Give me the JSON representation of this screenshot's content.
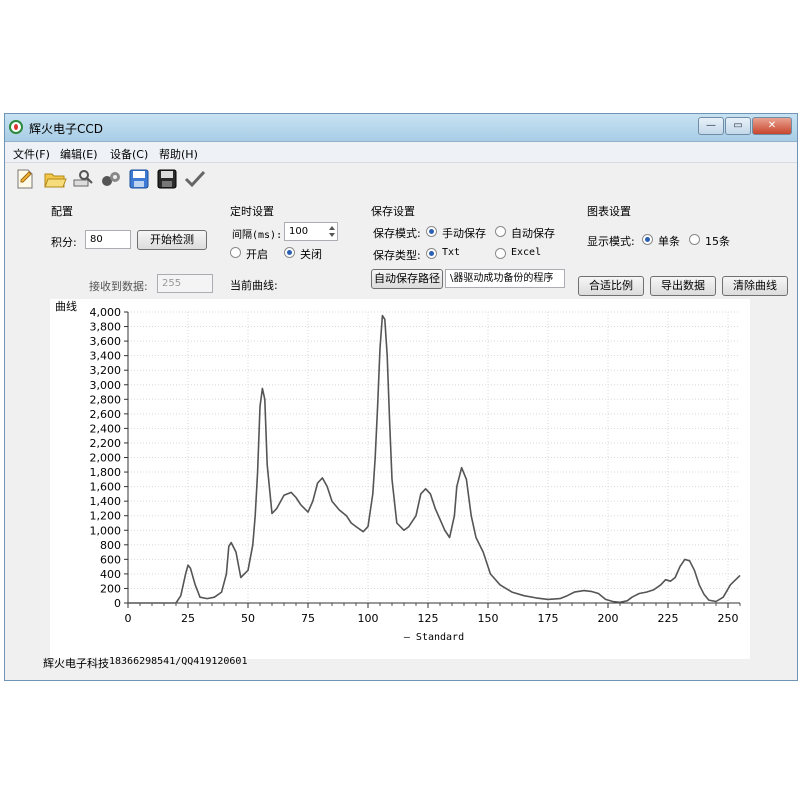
{
  "window": {
    "title": "辉火电子CCD",
    "minimize_label": "—",
    "maximize_label": "▭",
    "close_label": "✕"
  },
  "menu": [
    "文件(F)",
    "编辑(E)",
    "设备(C)",
    "帮助(H)"
  ],
  "toolbar": {
    "icons": [
      "new-file-icon",
      "open-folder-icon",
      "connect-icon",
      "device-icon",
      "save-icon",
      "save-as-icon",
      "check-icon"
    ]
  },
  "config": {
    "title": "配置",
    "integral_label": "积分:",
    "integral_value": "80",
    "start_button": "开始检测",
    "received_label": "接收到数据:",
    "received_value": "255"
  },
  "timer": {
    "title": "定时设置",
    "interval_label": "间隔(ms):",
    "interval_value": "100",
    "on_label": "开启",
    "off_label": "关闭",
    "selected": "off",
    "current_curve_label": "当前曲线:"
  },
  "save": {
    "title": "保存设置",
    "mode_label": "保存模式:",
    "mode_manual": "手动保存",
    "mode_auto": "自动保存",
    "mode_selected": "manual",
    "type_label": "保存类型:",
    "type_txt": "Txt",
    "type_excel": "Excel",
    "type_selected": "txt",
    "path_button": "自动保存路径",
    "path_value": "\\器驱动成功备份的程序"
  },
  "chart_settings": {
    "title": "图表设置",
    "display_label": "显示模式:",
    "single_label": "单条",
    "multi_label": "15条",
    "selected": "single"
  },
  "actions": {
    "fit_button": "合适比例",
    "export_button": "导出数据",
    "clear_button": "清除曲线"
  },
  "footer": {
    "company": "辉火电子科技",
    "contact": "18366298541/QQ419120601"
  },
  "chart_data": {
    "type": "line",
    "ylabel": "曲线",
    "xlabel": "",
    "legend": "— Standard",
    "legend_position": "bottom-center",
    "xlim": [
      0,
      255
    ],
    "ylim": [
      0,
      4000
    ],
    "xticks": [
      0,
      25,
      50,
      75,
      100,
      125,
      150,
      175,
      200,
      225,
      250
    ],
    "yticks": [
      0,
      200,
      400,
      600,
      800,
      1000,
      1200,
      1400,
      1600,
      1800,
      2000,
      2200,
      2400,
      2600,
      2800,
      3000,
      3200,
      3400,
      3600,
      3800,
      4000
    ],
    "ytick_labels": [
      "0",
      "200",
      "400",
      "600",
      "800",
      "1,000",
      "1,200",
      "1,400",
      "1,600",
      "1,800",
      "2,000",
      "2,200",
      "2,400",
      "2,600",
      "2,800",
      "3,000",
      "3,200",
      "3,400",
      "3,600",
      "3,800",
      "4,000"
    ],
    "grid": true,
    "line_color": "#555555",
    "series": [
      {
        "name": "Standard",
        "x": [
          0,
          10,
          20,
          22,
          24,
          25,
          26,
          28,
          30,
          33,
          36,
          39,
          41,
          42,
          43,
          45,
          47,
          50,
          52,
          53,
          54,
          55,
          56,
          57,
          58,
          60,
          62,
          65,
          68,
          70,
          72,
          75,
          77,
          79,
          81,
          83,
          85,
          88,
          91,
          93,
          95,
          98,
          100,
          102,
          103,
          104,
          105,
          106,
          107,
          108,
          109,
          110,
          112,
          115,
          117,
          120,
          122,
          124,
          126,
          128,
          130,
          132,
          134,
          136,
          137,
          139,
          141,
          143,
          145,
          148,
          151,
          155,
          160,
          165,
          170,
          175,
          180,
          183,
          186,
          190,
          193,
          196,
          199,
          202,
          205,
          208,
          210,
          213,
          216,
          219,
          222,
          224,
          226,
          228,
          230,
          232,
          234,
          236,
          238,
          240,
          242,
          245,
          248,
          251,
          255
        ],
        "y": [
          0,
          0,
          0,
          100,
          400,
          520,
          480,
          250,
          80,
          60,
          80,
          150,
          400,
          780,
          830,
          700,
          350,
          450,
          800,
          1200,
          1800,
          2700,
          2950,
          2800,
          1900,
          1230,
          1300,
          1480,
          1520,
          1450,
          1350,
          1250,
          1400,
          1650,
          1720,
          1600,
          1400,
          1280,
          1200,
          1100,
          1050,
          980,
          1050,
          1500,
          2000,
          2700,
          3500,
          3950,
          3900,
          3400,
          2500,
          1700,
          1100,
          1000,
          1050,
          1200,
          1500,
          1570,
          1500,
          1300,
          1150,
          1000,
          900,
          1200,
          1600,
          1860,
          1700,
          1200,
          900,
          700,
          400,
          250,
          150,
          100,
          70,
          50,
          60,
          100,
          150,
          170,
          160,
          130,
          50,
          20,
          10,
          30,
          80,
          130,
          150,
          180,
          250,
          320,
          300,
          350,
          500,
          600,
          580,
          450,
          250,
          120,
          40,
          20,
          80,
          250,
          380
        ]
      }
    ]
  }
}
